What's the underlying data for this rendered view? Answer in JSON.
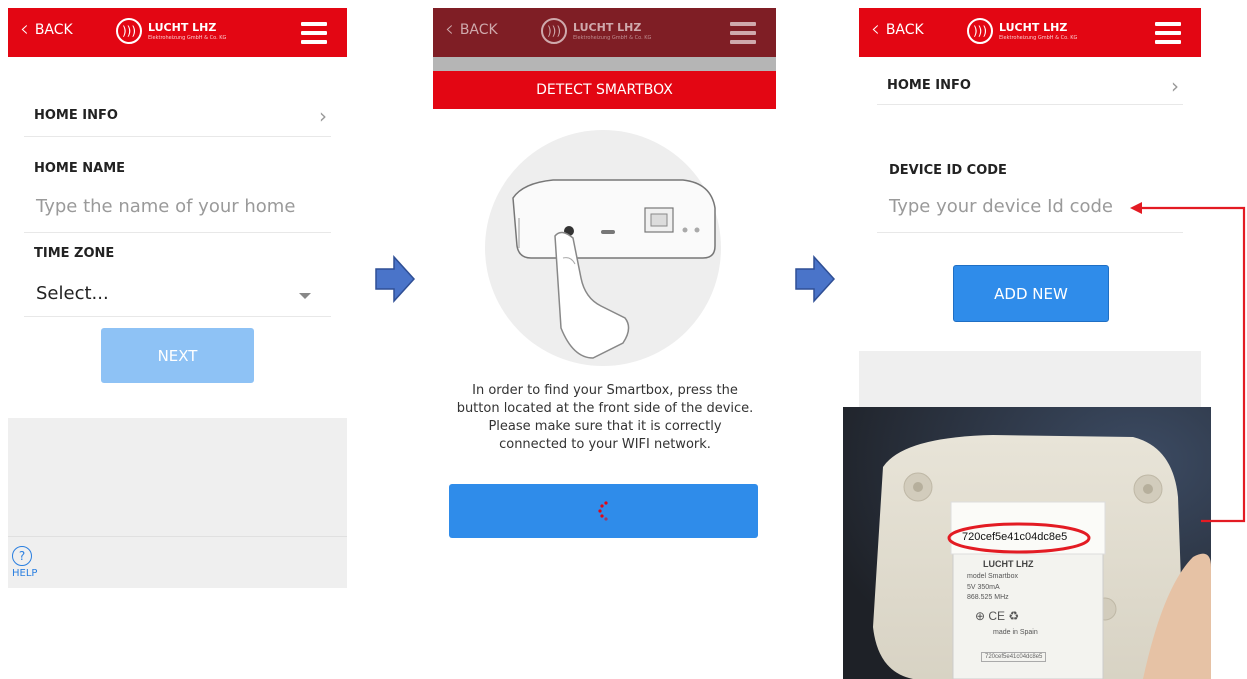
{
  "screen1": {
    "back_label": "BACK",
    "logo": {
      "brand": "LUCHT LHZ",
      "sub": "Elektroheizung GmbH & Co. KG"
    },
    "home_info_title": "HOME INFO",
    "home_name_label": "HOME NAME",
    "home_name_placeholder": "Type the name of your home",
    "time_zone_label": "TIME ZONE",
    "time_zone_value": "Select...",
    "next_label": "NEXT",
    "help_label": "HELP",
    "colors": {
      "header": "#e30613",
      "next_button": "#8ec2f5"
    }
  },
  "screen2": {
    "back_label": "BACK",
    "logo": {
      "brand": "LUCHT LHZ",
      "sub": "Elektroheizung GmbH & Co. KG"
    },
    "detect_title": "DETECT SMARTBOX",
    "description": "In order to find your Smartbox, press the button located at the front side of the device. Please make sure that it is correctly connected to your WIFI network.",
    "colors": {
      "header": "#7f1e25",
      "banner": "#e30613",
      "button": "#2f8cea"
    }
  },
  "screen3": {
    "back_label": "BACK",
    "logo": {
      "brand": "LUCHT LHZ",
      "sub": "Elektroheizung GmbH & Co. KG"
    },
    "home_info_title": "HOME INFO",
    "device_id_label": "DEVICE ID CODE",
    "device_id_placeholder": "Type your device Id code",
    "add_new_label": "ADD NEW",
    "colors": {
      "header": "#e30613",
      "button": "#2f8cea"
    }
  },
  "photo": {
    "device_id_code": "720cef5e41c04dc8e5",
    "label_brand": "LUCHT LHZ",
    "label_model": "model Smartbox",
    "label_specs": "5V  350mA",
    "label_freq": "868.525 MHz",
    "label_made": "made in Spain"
  }
}
